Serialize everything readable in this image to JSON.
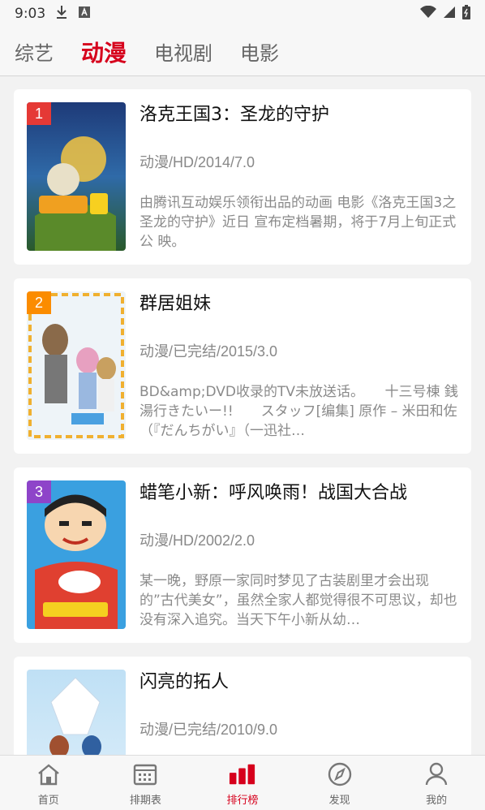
{
  "status": {
    "time": "9:03"
  },
  "tabs": [
    {
      "label": "综艺",
      "active": false
    },
    {
      "label": "动漫",
      "active": true
    },
    {
      "label": "电视剧",
      "active": false
    },
    {
      "label": "电影",
      "active": false
    }
  ],
  "items": [
    {
      "rank": "1",
      "rank_color": "#e53935",
      "title": "洛克王国3：圣龙的守护",
      "meta": "动漫/HD/2014/7.0",
      "desc": "由腾讯互动娱乐领衔出品的动画 电影《洛克王国3之圣龙的守护》近日 宣布定档暑期，将于7月上旬正式公 映。"
    },
    {
      "rank": "2",
      "rank_color": "#fb8c00",
      "title": "群居姐妹",
      "meta": "动漫/已完结/2015/3.0",
      "desc": "BD&amp;DVD收录的TV未放送话。　　十三号棟 銭湯行きたいー!!　　スタッフ[编集] 原作 – 米田和佐（『だんちがい』（一迅社…"
    },
    {
      "rank": "3",
      "rank_color": "#8e44c9",
      "title": "蜡笔小新：呼风唤雨！战国大合战",
      "meta": "动漫/HD/2002/2.0",
      "desc": "某一晚，野原一家同时梦见了古装剧里才会出现的”古代美女”，虽然全家人都觉得很不可思议，却也没有深入追究。当天下午小新从幼…"
    },
    {
      "rank": "",
      "rank_color": "#999999",
      "title": "闪亮的拓人",
      "meta": "动漫/已完结/2010/9.0",
      "desc": ""
    }
  ],
  "nav": [
    {
      "label": "首页",
      "icon": "home-icon"
    },
    {
      "label": "排期表",
      "icon": "calendar-icon"
    },
    {
      "label": "排行榜",
      "icon": "ranking-icon",
      "active": true
    },
    {
      "label": "发现",
      "icon": "compass-icon"
    },
    {
      "label": "我的",
      "icon": "profile-icon"
    }
  ],
  "colors": {
    "accent": "#d6001c"
  }
}
